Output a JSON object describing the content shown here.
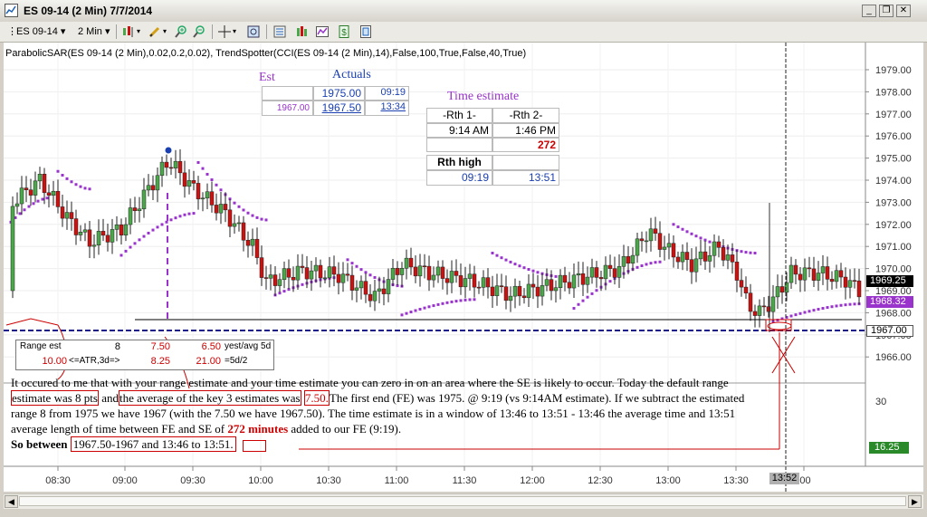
{
  "window": {
    "title": "ES 09-14 (2 Min)  7/7/2014"
  },
  "toolbar": {
    "instrument": "ES 09-14",
    "interval": "2 Min"
  },
  "indicator_line": "ParabolicSAR(ES 09-14 (2 Min),0.02,0.2,0.02), TrendSpotter(CCI(ES 09-14 (2 Min),14),False,100,True,False,40,True)",
  "est_table": {
    "est_header": "Est",
    "actuals_header": "Actuals",
    "row1": {
      "est": "",
      "actual": "1975.00",
      "time": "09:19"
    },
    "row2": {
      "est": "1967.00",
      "actual": "1967.50",
      "time": "13:34"
    }
  },
  "time_estimate": {
    "title": "Time estimate",
    "col1": "-Rth 1-",
    "col2": "-Rth 2-",
    "t1": "9:14 AM",
    "t2": "1:46 PM",
    "minutes": "272",
    "rth_high_label": "Rth high",
    "high_t1": "09:19",
    "high_t2": "13:51"
  },
  "range_table": {
    "label": "Range est",
    "v1": "8",
    "v2": "7.50",
    "v3": "6.50",
    "note1": "yest/avg 5d",
    "v4": "10.00",
    "label2": "<=ATR,3d=>",
    "v5": "8.25",
    "v6": "21.00",
    "note2": "=5d/2"
  },
  "notes": {
    "line1": "It occured to me that with your range estimate and your time estimate you can zero in on an area where the SE is likely to occur. Today the default range",
    "l2a": "estimate was 8 pts",
    "l2b": "and",
    "l2c": "the average of the key 3 estimates was",
    "l2d": "7.50.",
    "l2e": "The first end (FE) was 1975. @ 9:19 (vs 9:14AM estimate). If we subtract the estimated",
    "line3": "range 8 from 1975 we have 1967  (with the 7.50 we have 1967.50). The time estimate is in a window of 13:46 to 13:51 - 13:46 the average time and 13:51",
    "l4a": "average length of time between FE and SE of",
    "l4b": "272 minutes",
    "l4c": "added to our FE (9:19).",
    "l5a": "So between",
    "l5b": "1967.50-1967 and 13:46 to 13:51."
  },
  "price_axis": {
    "labels": [
      "1979.00",
      "1978.00",
      "1977.00",
      "1976.00",
      "1975.00",
      "1974.00",
      "1973.00",
      "1972.00",
      "1971.00",
      "1970.00",
      "1969.00",
      "1968.00",
      "1967.00",
      "1966.00"
    ],
    "last_price": "1969.25",
    "sar_price": "1968.32",
    "line_price": "1967.00"
  },
  "cci_axis": {
    "l30": "30",
    "l16": "16.25"
  },
  "time_axis": {
    "labels": [
      "08:30",
      "09:00",
      "09:30",
      "10:00",
      "10:30",
      "11:00",
      "11:30",
      "12:00",
      "12:30",
      "13:00",
      "13:30",
      ":00"
    ],
    "cursor": "13:52"
  },
  "colors": {
    "up": "#4aa84a",
    "down": "#cc1111",
    "sar": "#9933cc",
    "axis_text": "#333333",
    "annot": "#cc0000"
  }
}
